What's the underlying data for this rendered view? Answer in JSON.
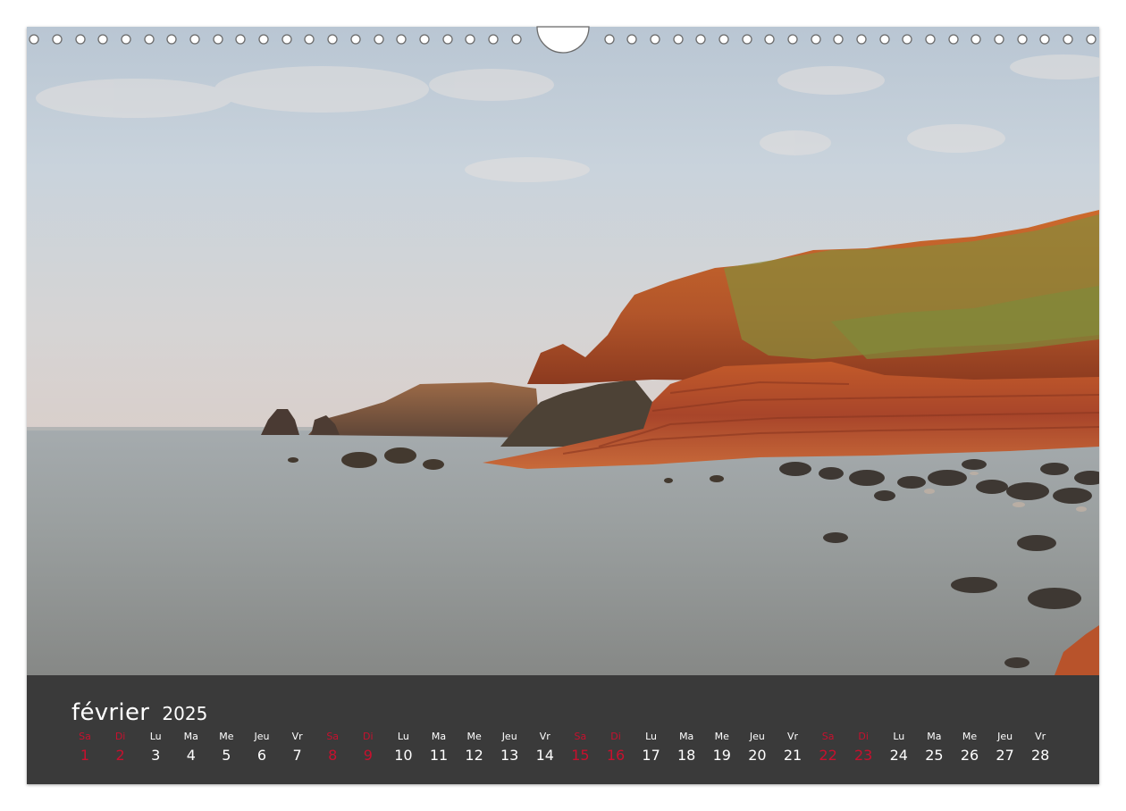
{
  "calendar": {
    "month": "février",
    "year": "2025",
    "days": [
      {
        "name": "Sa",
        "num": "1",
        "weekend": true
      },
      {
        "name": "Di",
        "num": "2",
        "weekend": true
      },
      {
        "name": "Lu",
        "num": "3",
        "weekend": false
      },
      {
        "name": "Ma",
        "num": "4",
        "weekend": false
      },
      {
        "name": "Me",
        "num": "5",
        "weekend": false
      },
      {
        "name": "Jeu",
        "num": "6",
        "weekend": false
      },
      {
        "name": "Vr",
        "num": "7",
        "weekend": false
      },
      {
        "name": "Sa",
        "num": "8",
        "weekend": true
      },
      {
        "name": "Di",
        "num": "9",
        "weekend": true
      },
      {
        "name": "Lu",
        "num": "10",
        "weekend": false
      },
      {
        "name": "Ma",
        "num": "11",
        "weekend": false
      },
      {
        "name": "Me",
        "num": "12",
        "weekend": false
      },
      {
        "name": "Jeu",
        "num": "13",
        "weekend": false
      },
      {
        "name": "Vr",
        "num": "14",
        "weekend": false
      },
      {
        "name": "Sa",
        "num": "15",
        "weekend": true
      },
      {
        "name": "Di",
        "num": "16",
        "weekend": true
      },
      {
        "name": "Lu",
        "num": "17",
        "weekend": false
      },
      {
        "name": "Ma",
        "num": "18",
        "weekend": false
      },
      {
        "name": "Me",
        "num": "19",
        "weekend": false
      },
      {
        "name": "Jeu",
        "num": "20",
        "weekend": false
      },
      {
        "name": "Vr",
        "num": "21",
        "weekend": false
      },
      {
        "name": "Sa",
        "num": "22",
        "weekend": true
      },
      {
        "name": "Di",
        "num": "23",
        "weekend": true
      },
      {
        "name": "Lu",
        "num": "24",
        "weekend": false
      },
      {
        "name": "Ma",
        "num": "25",
        "weekend": false
      },
      {
        "name": "Me",
        "num": "26",
        "weekend": false
      },
      {
        "name": "Jeu",
        "num": "27",
        "weekend": false
      },
      {
        "name": "Vr",
        "num": "28",
        "weekend": false
      }
    ]
  },
  "colors": {
    "bar_background": "#3a3a3a",
    "text": "#ffffff",
    "weekend": "#c8102e",
    "cliff": "#c2612a",
    "sea": "#8f9493",
    "sky": "#c9d3dc"
  }
}
